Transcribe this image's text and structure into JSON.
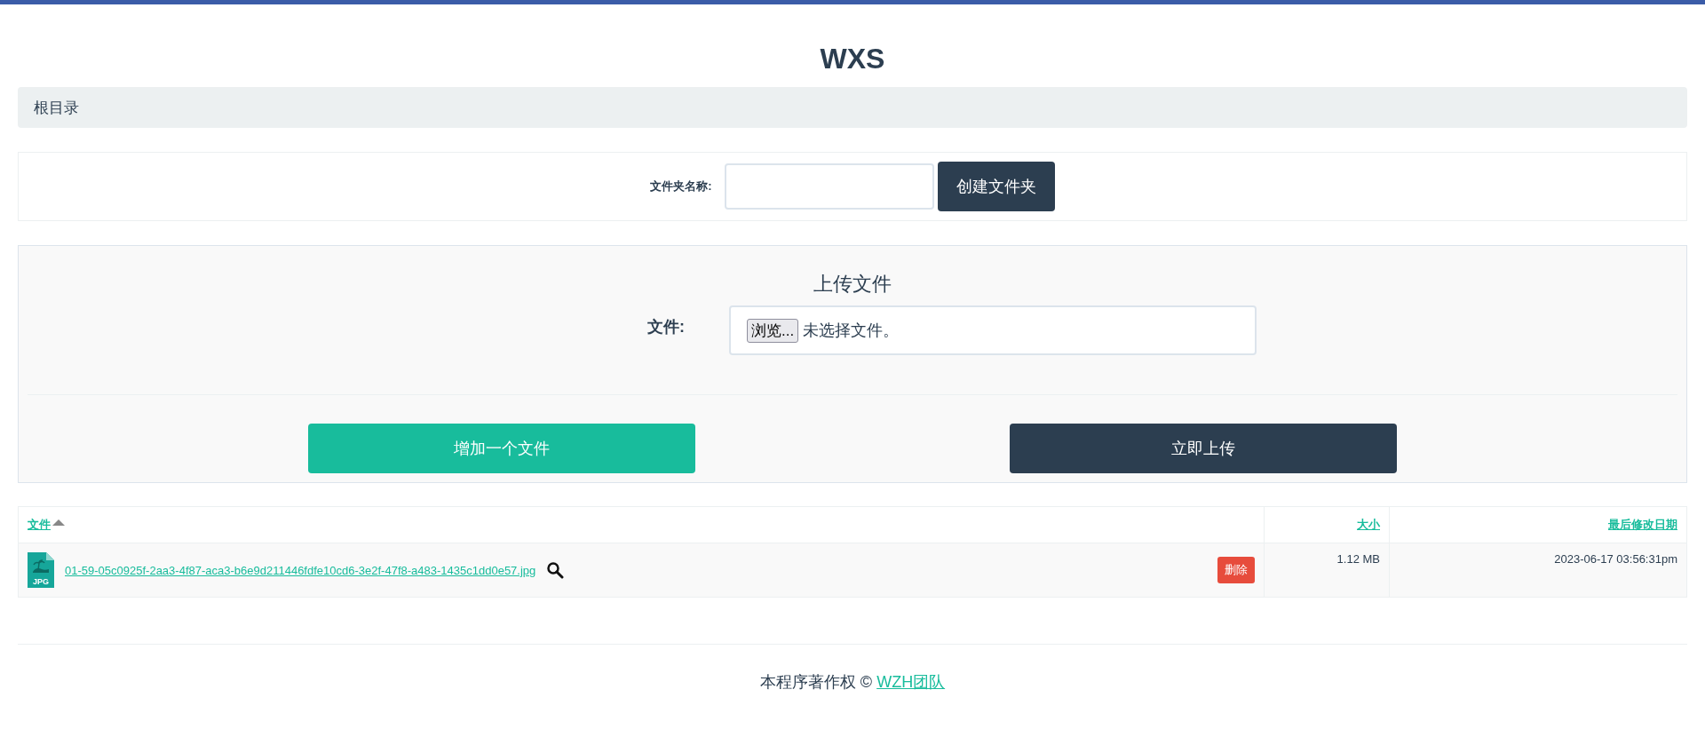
{
  "header": {
    "title": "WXS"
  },
  "breadcrumb": {
    "items": [
      "根目录"
    ]
  },
  "folder_form": {
    "label": "文件夹名称:",
    "button": "创建文件夹"
  },
  "upload": {
    "title": "上传文件",
    "label": "文件:",
    "browse_button": "浏览...",
    "file_status": "未选择文件。",
    "add_button": "增加一个文件",
    "submit_button": "立即上传"
  },
  "table": {
    "columns": [
      {
        "label": "文件",
        "sorted": true
      },
      {
        "label": "大小",
        "sorted": false
      },
      {
        "label": "最后修改日期",
        "sorted": false
      }
    ],
    "rows": [
      {
        "name": "01-59-05c0925f-2aa3-4f87-aca3-b6e9d211446fdfe10cd6-3e2f-47f8-a483-1435c1dd0e57.jpg",
        "icon_label": "JPG",
        "delete": "删除",
        "size": "1.12 MB",
        "modified": "2023-06-17 03:56:31pm"
      }
    ]
  },
  "footer": {
    "text": "本程序著作权 ©",
    "link": "WZH团队"
  }
}
